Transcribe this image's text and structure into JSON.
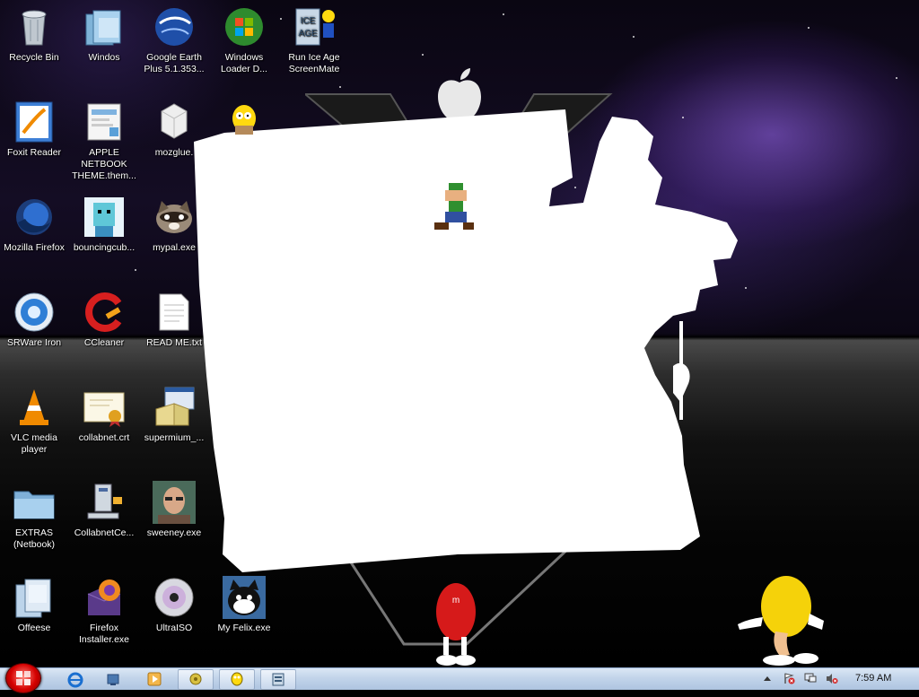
{
  "desktop_icons": [
    {
      "label": "Recycle Bin",
      "icon": "recycle-bin-icon"
    },
    {
      "label": "Windos",
      "icon": "folder-icon"
    },
    {
      "label": "Google Earth Plus 5.1.353...",
      "icon": "google-earth-icon"
    },
    {
      "label": "Windows Loader D...",
      "icon": "windows-orb-icon"
    },
    {
      "label": "Run Ice Age ScreenMate",
      "icon": "ice-age-icon"
    },
    {
      "label": "Foxit Reader",
      "icon": "foxit-reader-icon"
    },
    {
      "label": "APPLE NETBOOK THEME.them...",
      "icon": "theme-file-icon"
    },
    {
      "label": "mozglue.",
      "icon": "dll-file-icon"
    },
    {
      "label": "Mozilla Firefox",
      "icon": "firefox-icon"
    },
    {
      "label": "bouncingcub...",
      "icon": "bouncing-cube-icon"
    },
    {
      "label": "mypal.exe",
      "icon": "raccoon-icon"
    },
    {
      "label": "SRWare Iron",
      "icon": "srware-iron-icon"
    },
    {
      "label": "CCleaner",
      "icon": "ccleaner-icon"
    },
    {
      "label": "READ ME.txt",
      "icon": "text-file-icon"
    },
    {
      "label": "VLC media player",
      "icon": "vlc-cone-icon"
    },
    {
      "label": "collabnet.crt",
      "icon": "certificate-icon"
    },
    {
      "label": "supermium_...",
      "icon": "installer-box-icon"
    },
    {
      "label": "EXTRAS (Netbook)",
      "icon": "folder-blue-icon"
    },
    {
      "label": "CollabnetCe...",
      "icon": "network-computer-icon"
    },
    {
      "label": "sweeney.exe",
      "icon": "photo-person-icon"
    },
    {
      "label": "Offeese",
      "icon": "documents-icon"
    },
    {
      "label": "Firefox Installer.exe",
      "icon": "firefox-installer-icon"
    },
    {
      "label": "UltraISO",
      "icon": "ultraiso-disc-icon"
    },
    {
      "label": "My Felix.exe",
      "icon": "felix-cat-icon"
    }
  ],
  "taskbar": {
    "start_icon": "start-orb-icon",
    "quick_launch": [
      "internet-explorer-icon",
      "show-desktop-icon",
      "media-player-icon"
    ],
    "tasks": [
      "screenmate-task-icon",
      "homer-task-icon",
      "ice-age-task-icon"
    ],
    "tray": [
      "show-hidden-arrow-icon",
      "action-center-icon",
      "network-icon",
      "volume-muted-icon"
    ],
    "clock": "7:59 AM"
  }
}
